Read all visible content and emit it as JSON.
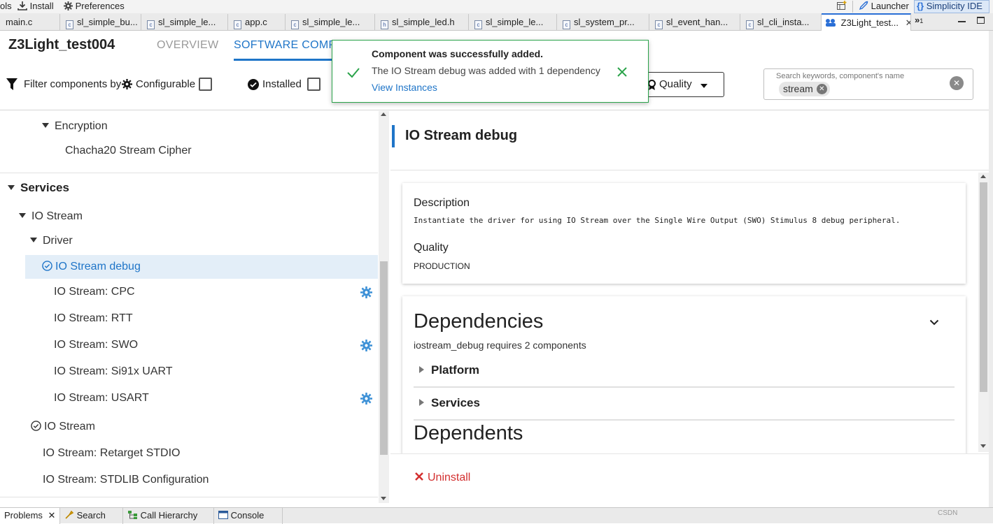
{
  "topbar": {
    "partial_label": "ols",
    "install": "Install",
    "preferences": "Preferences",
    "launcher": "Launcher",
    "ide": "Simplicity IDE"
  },
  "tabs": [
    {
      "label": "main.c"
    },
    {
      "label": "sl_simple_bu..."
    },
    {
      "label": "sl_simple_le..."
    },
    {
      "label": "app.c"
    },
    {
      "label": "sl_simple_le..."
    },
    {
      "label": "sl_simple_led.h"
    },
    {
      "label": "sl_simple_le..."
    },
    {
      "label": "sl_system_pr..."
    },
    {
      "label": "sl_event_han..."
    },
    {
      "label": "sl_cli_insta..."
    },
    {
      "label": "Z3Light_test..."
    }
  ],
  "tabs_overflow": "1",
  "header": {
    "project_title": "Z3Light_test004",
    "tab_overview": "OVERVIEW",
    "tab_software": "SOFTWARE COMPO"
  },
  "filter": {
    "label": "Filter components by",
    "configurable": "Configurable",
    "installed": "Installed",
    "quality": "Quality",
    "search_placeholder": "Search keywords, component's name",
    "search_chip": "stream"
  },
  "toast": {
    "title": "Component was successfully added.",
    "message": "The IO Stream debug was added with 1 dependency",
    "link": "View Instances"
  },
  "tree": {
    "encryption": "Encryption",
    "chacha": "Chacha20 Stream Cipher",
    "services": "Services",
    "io_stream": "IO Stream",
    "driver": "Driver",
    "io_debug": "IO Stream debug",
    "cpc": "IO Stream: CPC",
    "rtt": "IO Stream: RTT",
    "swo": "IO Stream: SWO",
    "si91x": "IO Stream: Si91x UART",
    "usart": "IO Stream: USART",
    "io_stream2": "IO Stream",
    "retarget": "IO Stream: Retarget STDIO",
    "stdlib": "IO Stream: STDLIB Configuration"
  },
  "detail": {
    "title": "IO Stream debug",
    "description_label": "Description",
    "description_text": "Instantiate the driver for using IO Stream over the Single Wire Output (SWO) Stimulus 8 debug peripheral.",
    "quality_label": "Quality",
    "quality_value": "PRODUCTION",
    "dependencies_title": "Dependencies",
    "dependencies_sub": "iostream_debug requires 2 components",
    "dep_platform": "Platform",
    "dep_services": "Services",
    "dependents_title": "Dependents",
    "uninstall": "Uninstall"
  },
  "bottom": {
    "problems": "Problems",
    "search": "Search",
    "call_hierarchy": "Call Hierarchy",
    "console": "Console",
    "watermark": "CSDN"
  },
  "colors": {
    "accent": "#1f75c8",
    "success": "#2aa34a",
    "danger": "#d32f2f",
    "selected_row": "#e3eef8"
  }
}
